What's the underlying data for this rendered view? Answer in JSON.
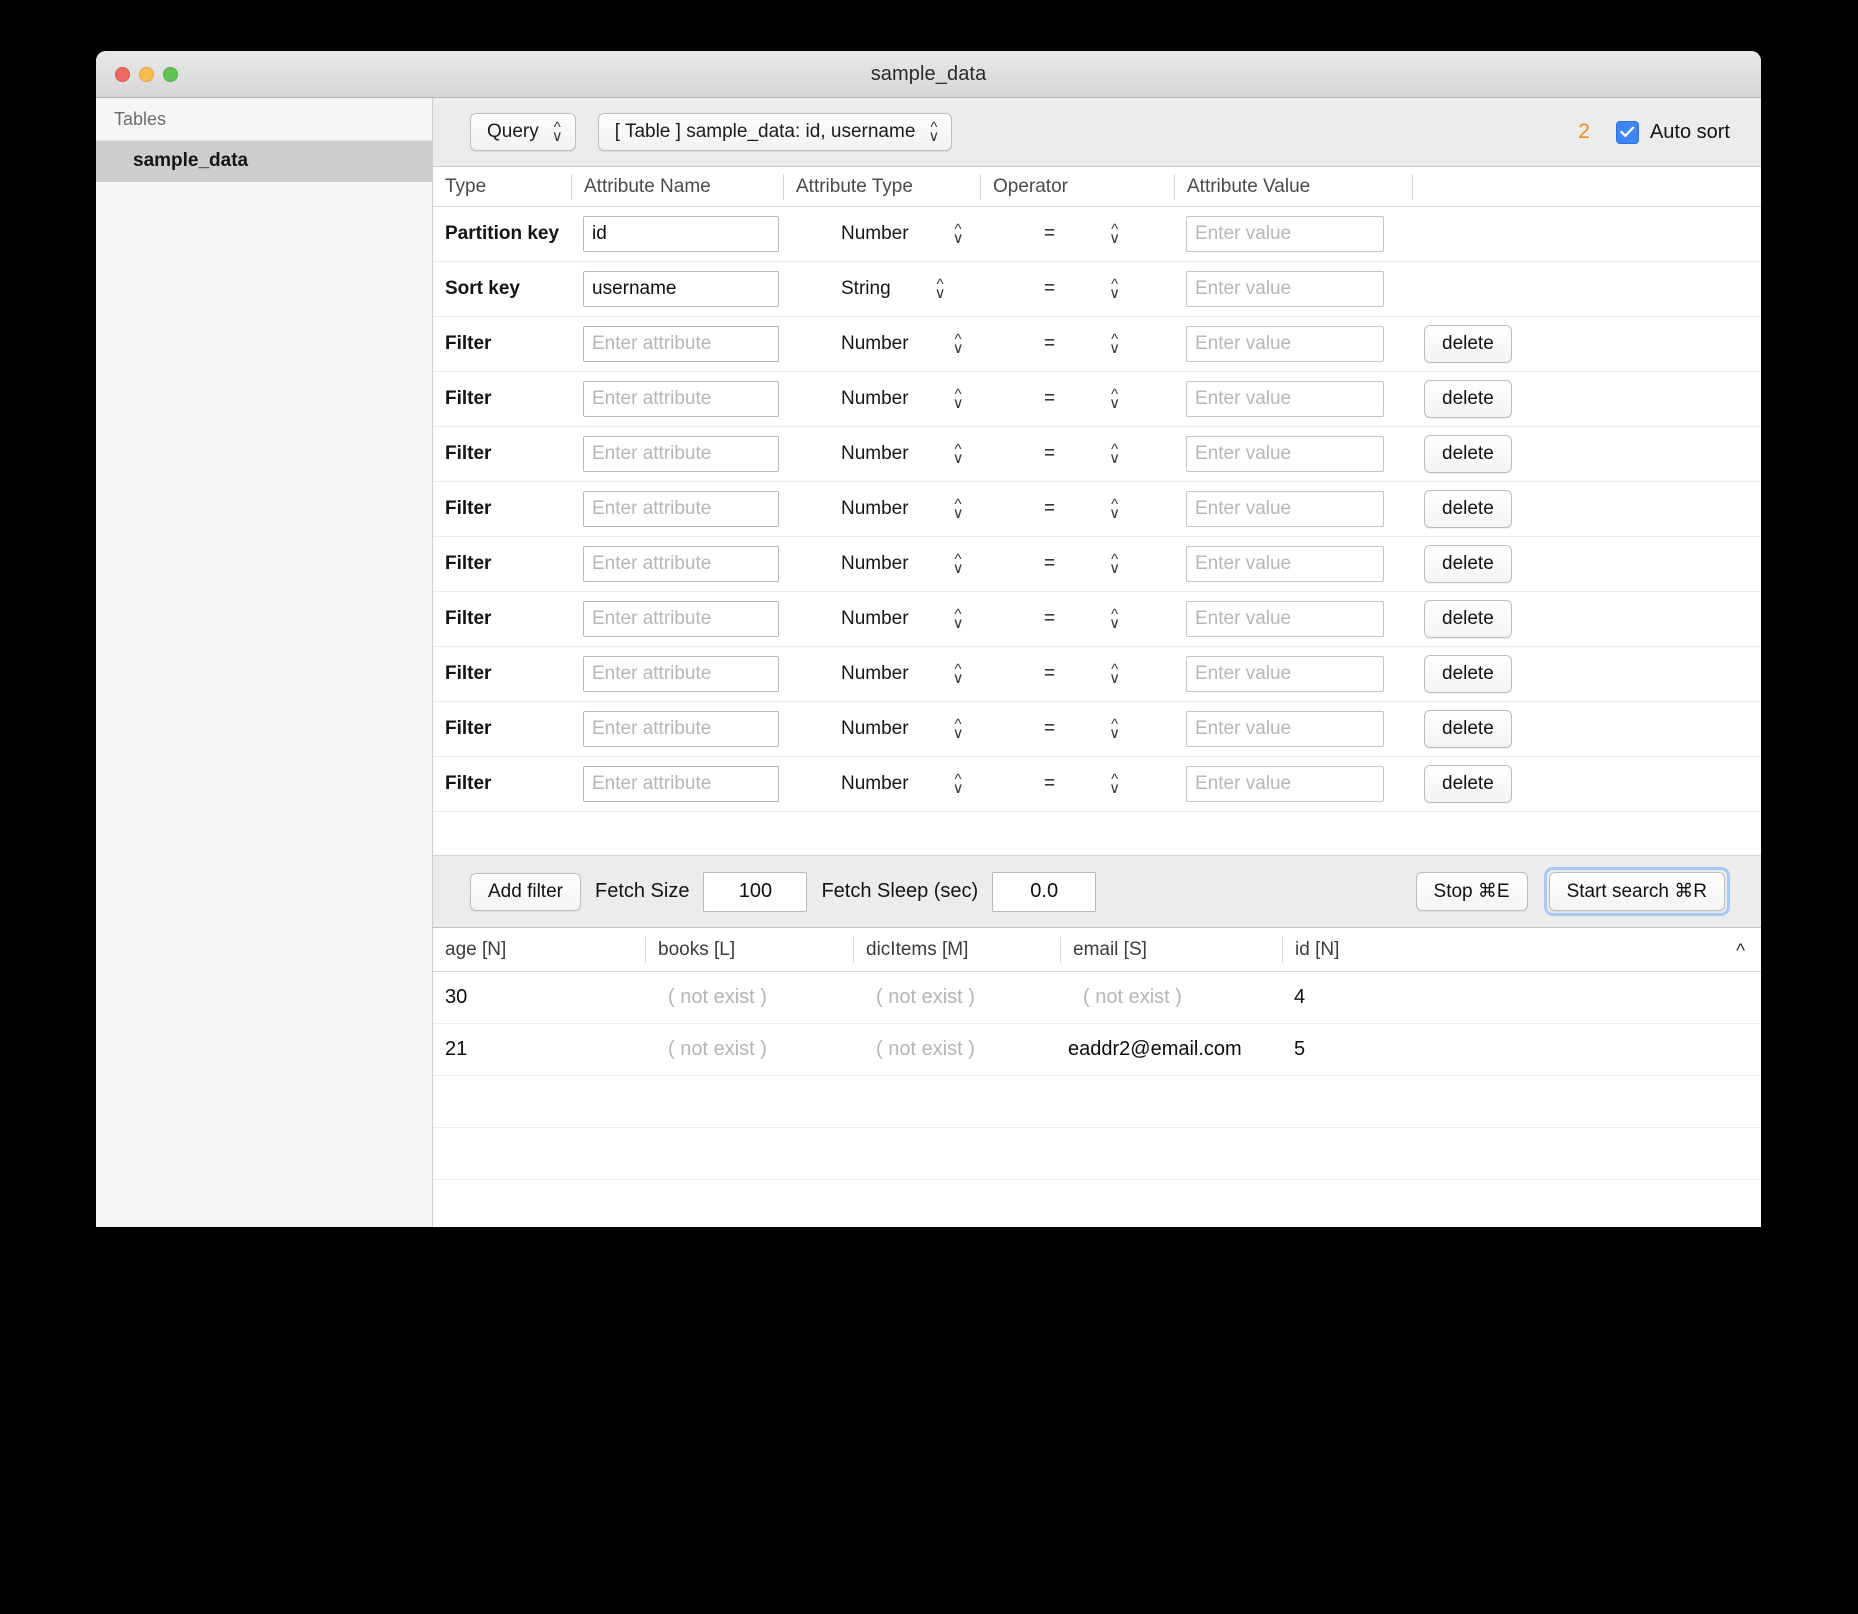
{
  "window": {
    "title": "sample_data",
    "controls": {
      "close": "close",
      "minimize": "minimize",
      "zoom": "zoom"
    }
  },
  "sidebar": {
    "header": "Tables",
    "items": [
      {
        "label": "sample_data",
        "selected": true
      }
    ]
  },
  "toolbar": {
    "mode_popup": "Query",
    "table_popup": "[ Table ] sample_data: id, username",
    "result_count": "2",
    "auto_sort_label": "Auto sort",
    "auto_sort_checked": true,
    "accent_color": "#3d84f7",
    "counter_color": "#ee8b22"
  },
  "filter_table": {
    "headers": [
      "Type",
      "Attribute Name",
      "Attribute Type",
      "Operator",
      "Attribute Value",
      ""
    ],
    "placeholders": {
      "attribute": "Enter attribute",
      "value": "Enter value"
    },
    "delete_label": "delete",
    "rows": [
      {
        "type": "Partition key",
        "attribute_name": "id",
        "attribute_type": "Number",
        "operator": "=",
        "attribute_value": "",
        "deletable": false
      },
      {
        "type": "Sort key",
        "attribute_name": "username",
        "attribute_type": "String",
        "operator": "=",
        "attribute_value": "",
        "deletable": false
      },
      {
        "type": "Filter",
        "attribute_name": "",
        "attribute_type": "Number",
        "operator": "=",
        "attribute_value": "",
        "deletable": true
      },
      {
        "type": "Filter",
        "attribute_name": "",
        "attribute_type": "Number",
        "operator": "=",
        "attribute_value": "",
        "deletable": true
      },
      {
        "type": "Filter",
        "attribute_name": "",
        "attribute_type": "Number",
        "operator": "=",
        "attribute_value": "",
        "deletable": true
      },
      {
        "type": "Filter",
        "attribute_name": "",
        "attribute_type": "Number",
        "operator": "=",
        "attribute_value": "",
        "deletable": true
      },
      {
        "type": "Filter",
        "attribute_name": "",
        "attribute_type": "Number",
        "operator": "=",
        "attribute_value": "",
        "deletable": true
      },
      {
        "type": "Filter",
        "attribute_name": "",
        "attribute_type": "Number",
        "operator": "=",
        "attribute_value": "",
        "deletable": true
      },
      {
        "type": "Filter",
        "attribute_name": "",
        "attribute_type": "Number",
        "operator": "=",
        "attribute_value": "",
        "deletable": true
      },
      {
        "type": "Filter",
        "attribute_name": "",
        "attribute_type": "Number",
        "operator": "=",
        "attribute_value": "",
        "deletable": true
      },
      {
        "type": "Filter",
        "attribute_name": "",
        "attribute_type": "Number",
        "operator": "=",
        "attribute_value": "",
        "deletable": true
      }
    ]
  },
  "action_bar": {
    "add_filter_label": "Add filter",
    "fetch_size_label": "Fetch Size",
    "fetch_size_value": "100",
    "fetch_sleep_label": "Fetch Sleep (sec)",
    "fetch_sleep_value": "0.0",
    "stop_label": "Stop ⌘E",
    "start_label": "Start search ⌘R"
  },
  "results": {
    "columns": [
      "age [N]",
      "books [L]",
      "dicItems [M]",
      "email [S]",
      "id [N]"
    ],
    "sort_direction": "asc",
    "not_exist_text": "( not exist )",
    "rows": [
      {
        "age": "30",
        "books": "( not exist )",
        "dicItems": "( not exist )",
        "email": "( not exist )",
        "id": "4"
      },
      {
        "age": "21",
        "books": "( not exist )",
        "dicItems": "( not exist )",
        "email": "eaddr2@email.com",
        "id": "5"
      }
    ],
    "empty_row_count": 6
  }
}
